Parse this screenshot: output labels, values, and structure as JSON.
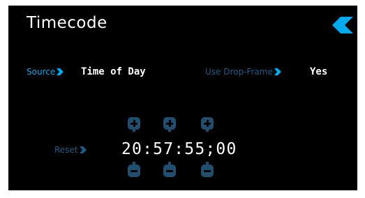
{
  "header": {
    "title": "Timecode",
    "back_icon": "back-chevron-icon"
  },
  "settings": {
    "source": {
      "label": "Source",
      "value": "Time of Day"
    },
    "drop_frame": {
      "label": "Use Drop-Frame",
      "value": "Yes"
    }
  },
  "timecode": {
    "reset_label": "Reset",
    "display": "20:57:55;00",
    "increment_icon": "plus-icon",
    "decrement_icon": "minus-icon"
  },
  "colors": {
    "accent": "#00aaee",
    "dim_accent": "#1f5c8a",
    "stepper": "#1f4e6e",
    "background": "#000000",
    "text": "#ffffff"
  }
}
